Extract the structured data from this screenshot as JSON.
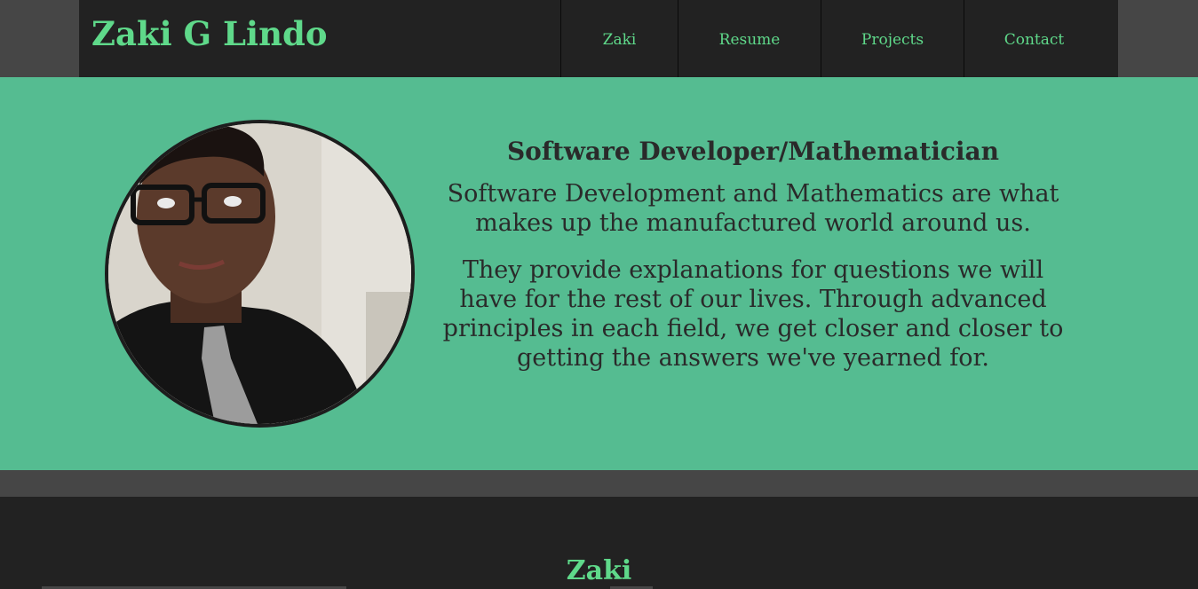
{
  "header": {
    "brand": "Zaki G Lindo",
    "nav": [
      {
        "label": "Zaki"
      },
      {
        "label": "Resume"
      },
      {
        "label": "Projects"
      },
      {
        "label": "Contact"
      }
    ]
  },
  "hero": {
    "title": "Software Developer/Mathematician",
    "paragraphs": [
      "Software Development and Mathematics are what makes up the manufactured world around us.",
      "They provide explanations for questions we will have for the rest of our lives. Through advanced principles in each field, we get closer and closer to getting the answers we've yearned for."
    ],
    "photo_icon": "profile-photo"
  },
  "section": {
    "title": "Zaki"
  },
  "colors": {
    "accent_green": "#5fd98a",
    "hero_bg": "#55bc91",
    "dark_bg": "#222222",
    "band_bg": "#464646"
  }
}
